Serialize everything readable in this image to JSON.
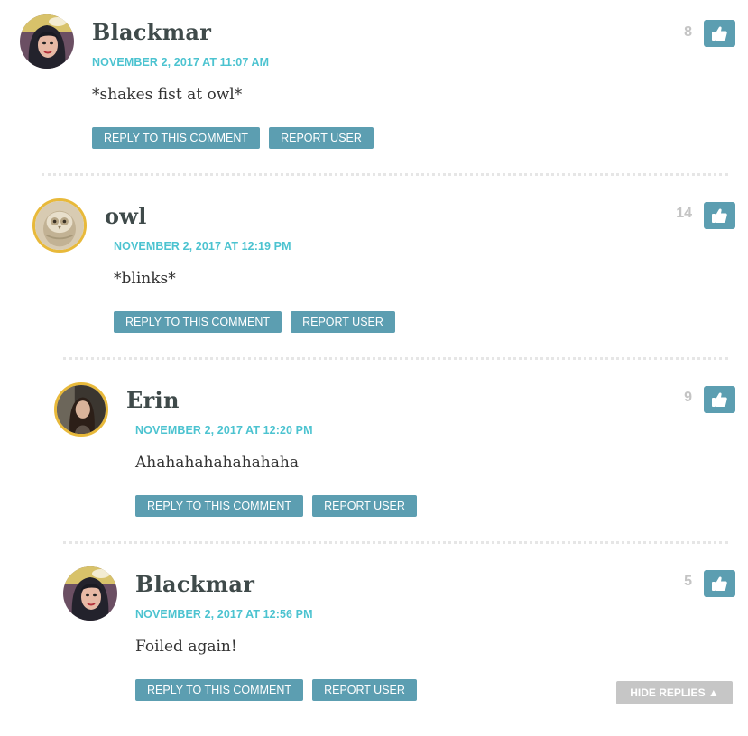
{
  "comments": [
    {
      "author": "Blackmar",
      "date": "NOVEMBER 2, 2017 AT 11:07 AM",
      "text": "*shakes fist at owl*",
      "votes": "8",
      "reply_label": "REPLY TO THIS COMMENT",
      "report_label": "REPORT USER",
      "avatar": "comic-woman-avatar"
    },
    {
      "author": "owl",
      "date": "NOVEMBER 2, 2017 AT 12:19 PM",
      "text": "*blinks*",
      "votes": "14",
      "reply_label": "REPLY TO THIS COMMENT",
      "report_label": "REPORT USER",
      "avatar": "owl-avatar"
    },
    {
      "author": "Erin",
      "date": "NOVEMBER 2, 2017 AT 12:20 PM",
      "text": "Ahahahahahahahaha",
      "votes": "9",
      "reply_label": "REPLY TO THIS COMMENT",
      "report_label": "REPORT USER",
      "avatar": "woman-photo-avatar"
    },
    {
      "author": "Blackmar",
      "date": "NOVEMBER 2, 2017 AT 12:56 PM",
      "text": "Foiled again!",
      "votes": "5",
      "reply_label": "REPLY TO THIS COMMENT",
      "report_label": "REPORT USER",
      "avatar": "comic-woman-avatar"
    }
  ],
  "hide_replies_label": "HIDE REPLIES ▲",
  "colors": {
    "accent": "#4cc3d0",
    "button": "#5c9eb1",
    "avatar_ring": "#e8b93a",
    "vote_count": "#c4c4c4",
    "hide_replies_bg": "#c6c6c6"
  },
  "icons": {
    "like": "thumbs-up-icon"
  }
}
